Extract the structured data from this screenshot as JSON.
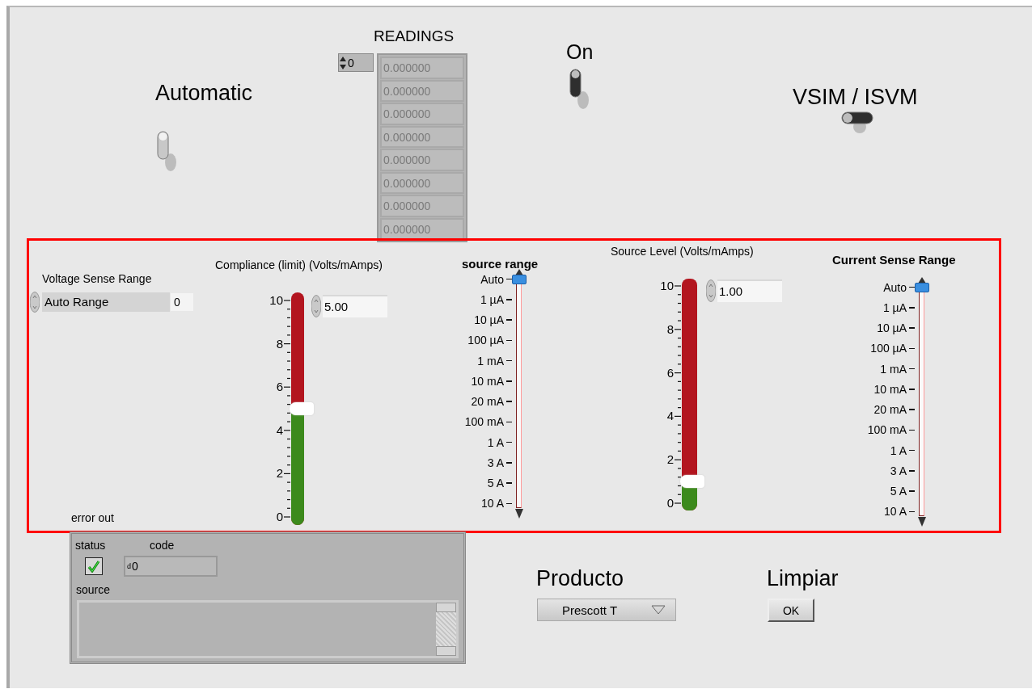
{
  "readings": {
    "label": "READINGS",
    "index": "0",
    "values": [
      "0.000000",
      "0.000000",
      "0.000000",
      "0.000000",
      "0.000000",
      "0.000000",
      "0.000000",
      "0.000000"
    ]
  },
  "switches": [
    {
      "label": "Automatic",
      "kind": "vertical",
      "on": false
    },
    {
      "label": "On",
      "kind": "vertical",
      "on": true
    },
    {
      "label": "VSIM / ISVM",
      "kind": "horizontal",
      "on": true
    }
  ],
  "voltage_sense_range": {
    "label": "Voltage Sense Range",
    "value": "Auto Range",
    "number": "0"
  },
  "sliders": [
    {
      "label": "Compliance (limit) (Volts/mAmps)",
      "level": 0.5,
      "value": "5.00",
      "ticks": [
        "10",
        "8",
        "6",
        "4",
        "2",
        "0"
      ]
    },
    {
      "label": "Source Level (Volts/mAmps)",
      "level": 0.1,
      "value": "1.00",
      "ticks": [
        "10",
        "8",
        "6",
        "4",
        "2",
        "0"
      ]
    }
  ],
  "range_selectors": [
    {
      "label": "source range",
      "items": [
        {
          "label": "Auto",
          "selected": true
        },
        {
          "label": "1 µA",
          "selected": false
        },
        {
          "label": "10 µA",
          "selected": false
        },
        {
          "label": "100 µA",
          "selected": false
        },
        {
          "label": "1 mA",
          "selected": false
        },
        {
          "label": "10 mA",
          "selected": false
        },
        {
          "label": "20 mA",
          "selected": false
        },
        {
          "label": "100 mA",
          "selected": false
        },
        {
          "label": "1 A",
          "selected": false
        },
        {
          "label": "3 A",
          "selected": false
        },
        {
          "label": "5 A",
          "selected": false
        },
        {
          "label": "10 A",
          "selected": false
        }
      ]
    },
    {
      "label": "Current Sense Range",
      "items": [
        {
          "label": "Auto",
          "selected": true
        },
        {
          "label": "1 µA",
          "selected": false
        },
        {
          "label": "10 µA",
          "selected": false
        },
        {
          "label": "100 µA",
          "selected": false
        },
        {
          "label": "1 mA",
          "selected": false
        },
        {
          "label": "10 mA",
          "selected": false
        },
        {
          "label": "20 mA",
          "selected": false
        },
        {
          "label": "100 mA",
          "selected": false
        },
        {
          "label": "1 A",
          "selected": false
        },
        {
          "label": "3 A",
          "selected": false
        },
        {
          "label": "5 A",
          "selected": false
        },
        {
          "label": "10 A",
          "selected": false
        }
      ]
    }
  ],
  "error_out": {
    "label": "error out",
    "status_label": "status",
    "status_checked": true,
    "code_label": "code",
    "code_radix": "d",
    "code": "0",
    "source_label": "source"
  },
  "producto": {
    "label": "Producto",
    "value": "Prescott T"
  },
  "limpiar": {
    "label": "Limpiar",
    "button": "OK"
  }
}
